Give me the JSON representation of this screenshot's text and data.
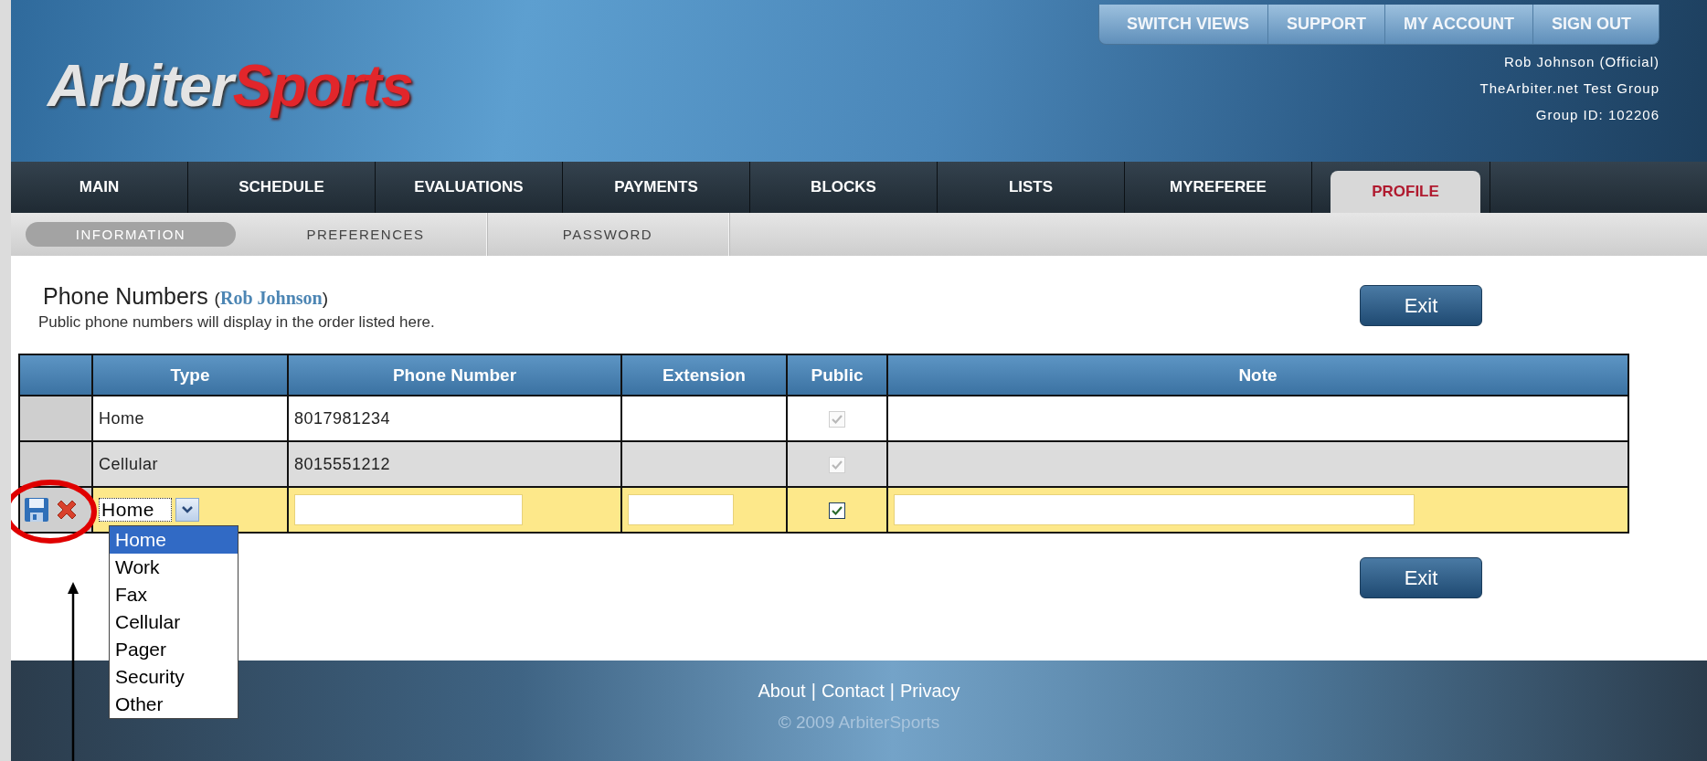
{
  "header": {
    "logo": {
      "part_1": "Arbiter",
      "part_2": "Sports"
    },
    "top_links": [
      "SWITCH VIEWS",
      "SUPPORT",
      "MY ACCOUNT",
      "SIGN OUT"
    ],
    "user_info": [
      "Rob Johnson (Official)",
      "TheArbiter.net Test Group",
      "Group ID: 102206"
    ]
  },
  "main_tabs": [
    {
      "label": "MAIN",
      "selected": false
    },
    {
      "label": "SCHEDULE",
      "selected": false
    },
    {
      "label": "EVALUATIONS",
      "selected": false
    },
    {
      "label": "PAYMENTS",
      "selected": false
    },
    {
      "label": "BLOCKS",
      "selected": false
    },
    {
      "label": "LISTS",
      "selected": false
    },
    {
      "label": "MYREFEREE",
      "selected": false
    },
    {
      "label": "PROFILE",
      "selected": true
    }
  ],
  "sub_tabs": [
    {
      "label": "INFORMATION",
      "selected": true
    },
    {
      "label": "PREFERENCES",
      "selected": false
    },
    {
      "label": "PASSWORD",
      "selected": false
    }
  ],
  "page": {
    "title": "Phone Numbers",
    "owner_open": "(",
    "owner": "Rob Johnson",
    "owner_close": ")",
    "subtitle": "Public phone numbers will display in the order listed here.",
    "exit_buttons": [
      "Exit",
      "Exit"
    ]
  },
  "table": {
    "columns": [
      "Type",
      "Phone Number",
      "Extension",
      "Public",
      "Note"
    ],
    "rows": [
      {
        "kind": "view",
        "type": "Home",
        "phone_number": "8017981234",
        "public": true,
        "disabled": true
      },
      {
        "kind": "view",
        "type": "Cellular",
        "phone_number": "8015551212",
        "public": true,
        "disabled": true
      },
      {
        "kind": "edit",
        "type": "Home",
        "public": true,
        "disabled": false
      }
    ]
  },
  "type_dropdown": {
    "options": [
      {
        "label": "Home",
        "selected": true
      },
      {
        "label": "Work",
        "selected": false
      },
      {
        "label": "Fax",
        "selected": false
      },
      {
        "label": "Cellular",
        "selected": false
      },
      {
        "label": "Pager",
        "selected": false
      },
      {
        "label": "Security",
        "selected": false
      },
      {
        "label": "Other",
        "selected": false
      }
    ]
  },
  "footer": {
    "links": [
      "About",
      "Contact",
      "Privacy"
    ],
    "separator": "|",
    "copyright": "© 2009 ArbiterSports"
  }
}
